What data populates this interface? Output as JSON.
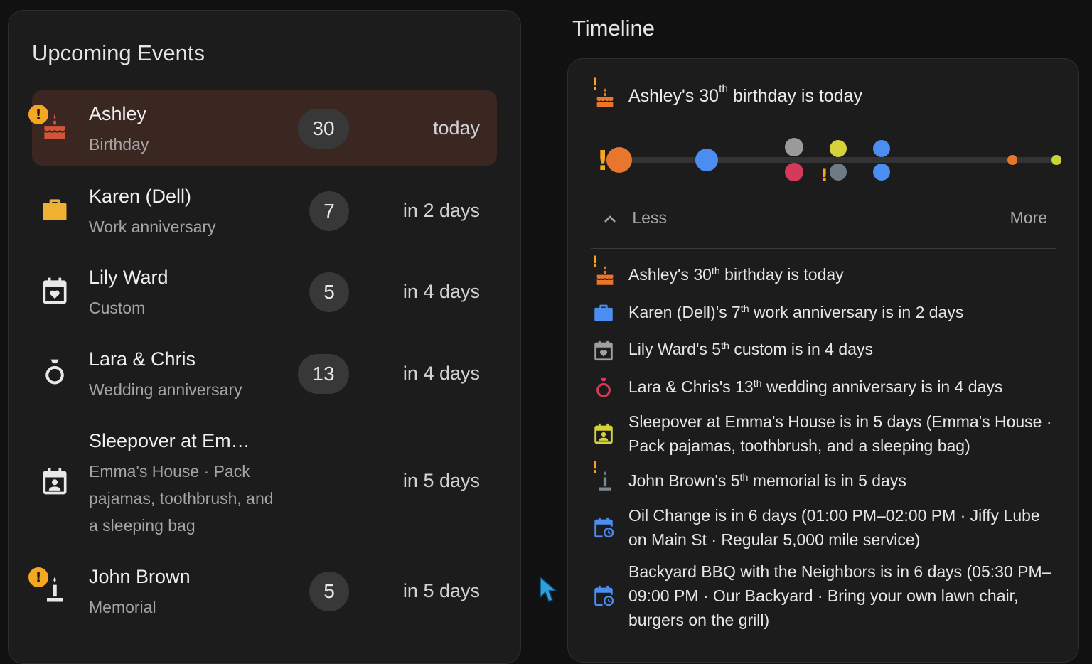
{
  "upcoming": {
    "title": "Upcoming Events",
    "events": [
      {
        "name": "Ashley",
        "sub": "Birthday",
        "badge": "30",
        "when": "today",
        "icon": "birthday-cake-icon",
        "color": "#d0553a",
        "alert": "!"
      },
      {
        "name": "Karen (Dell)",
        "sub": "Work anniversary",
        "badge": "7",
        "when": "in 2 days",
        "icon": "briefcase-icon",
        "color": "#f0b133"
      },
      {
        "name": "Lily Ward",
        "sub": "Custom",
        "badge": "5",
        "when": "in 4 days",
        "icon": "calendar-heart-icon",
        "color": "#e8e8e8"
      },
      {
        "name": "Lara & Chris",
        "sub": "Wedding anniversary",
        "badge": "13",
        "when": "in 4 days",
        "icon": "ring-icon",
        "color": "#e8e8e8"
      },
      {
        "name": "Sleepover at Em…",
        "sub": "Emma's House · Pack pajamas, toothbrush, and a sleeping bag",
        "when": "in 5 days",
        "icon": "calendar-account-icon",
        "color": "#e8e8e8"
      },
      {
        "name": "John Brown",
        "sub": "Memorial",
        "badge": "5",
        "when": "in 5 days",
        "icon": "candle-icon",
        "color": "#e8e8e8",
        "alert": "!"
      }
    ]
  },
  "timeline": {
    "title": "Timeline",
    "headline": {
      "pre": "Ashley's 30",
      "sup": "th",
      "post": " birthday is today",
      "icon": "birthday-cake-icon"
    },
    "less_label": "Less",
    "more_label": "More",
    "alert_glyph": "!",
    "dot_colors": {
      "orange": "#e8762d",
      "blue": "#4b8df0",
      "gray": "#9a9a9a",
      "crimson": "#d63a5a",
      "yellow": "#d6d23a",
      "slate": "#6e7a86",
      "lime": "#c8d43a",
      "track": "#333333"
    },
    "items": [
      {
        "pre": "Ashley's 30",
        "sup": "th",
        "post": " birthday is today",
        "icon": "birthday-cake-icon",
        "color": "#e8762d",
        "alert": true
      },
      {
        "pre": "Karen (Dell)'s 7",
        "sup": "th",
        "post": " work anniversary is in 2 days",
        "icon": "briefcase-icon",
        "color": "#4b8df0"
      },
      {
        "pre": "Lily Ward's 5",
        "sup": "th",
        "post": " custom is in 4 days",
        "icon": "calendar-heart-icon",
        "color": "#a0a0a0"
      },
      {
        "pre": "Lara & Chris's 13",
        "sup": "th",
        "post": " wedding anniversary is in 4 days",
        "icon": "ring-icon",
        "color": "#d63a5a"
      },
      {
        "pre": "Sleepover at Emma's House is in 5 days (Emma's House · Pack pajamas, toothbrush, and a sleeping bag)",
        "icon": "calendar-account-icon",
        "color": "#d6d23a"
      },
      {
        "pre": "John Brown's 5",
        "sup": "th",
        "post": " memorial is in 5 days",
        "icon": "candle-icon",
        "color": "#7d8894",
        "alert": true
      },
      {
        "pre": "Oil Change is in 6 days (01:00 PM–02:00 PM · Jiffy Lube on Main St · Regular 5,000 mile service)",
        "icon": "calendar-clock-icon",
        "color": "#4b8df0"
      },
      {
        "pre": "Backyard BBQ with the Neighbors is in 6 days (05:30 PM–09:00 PM · Our Backyard · Bring your own lawn chair, burgers on the grill)",
        "icon": "calendar-clock-icon",
        "color": "#4b8df0"
      }
    ]
  }
}
